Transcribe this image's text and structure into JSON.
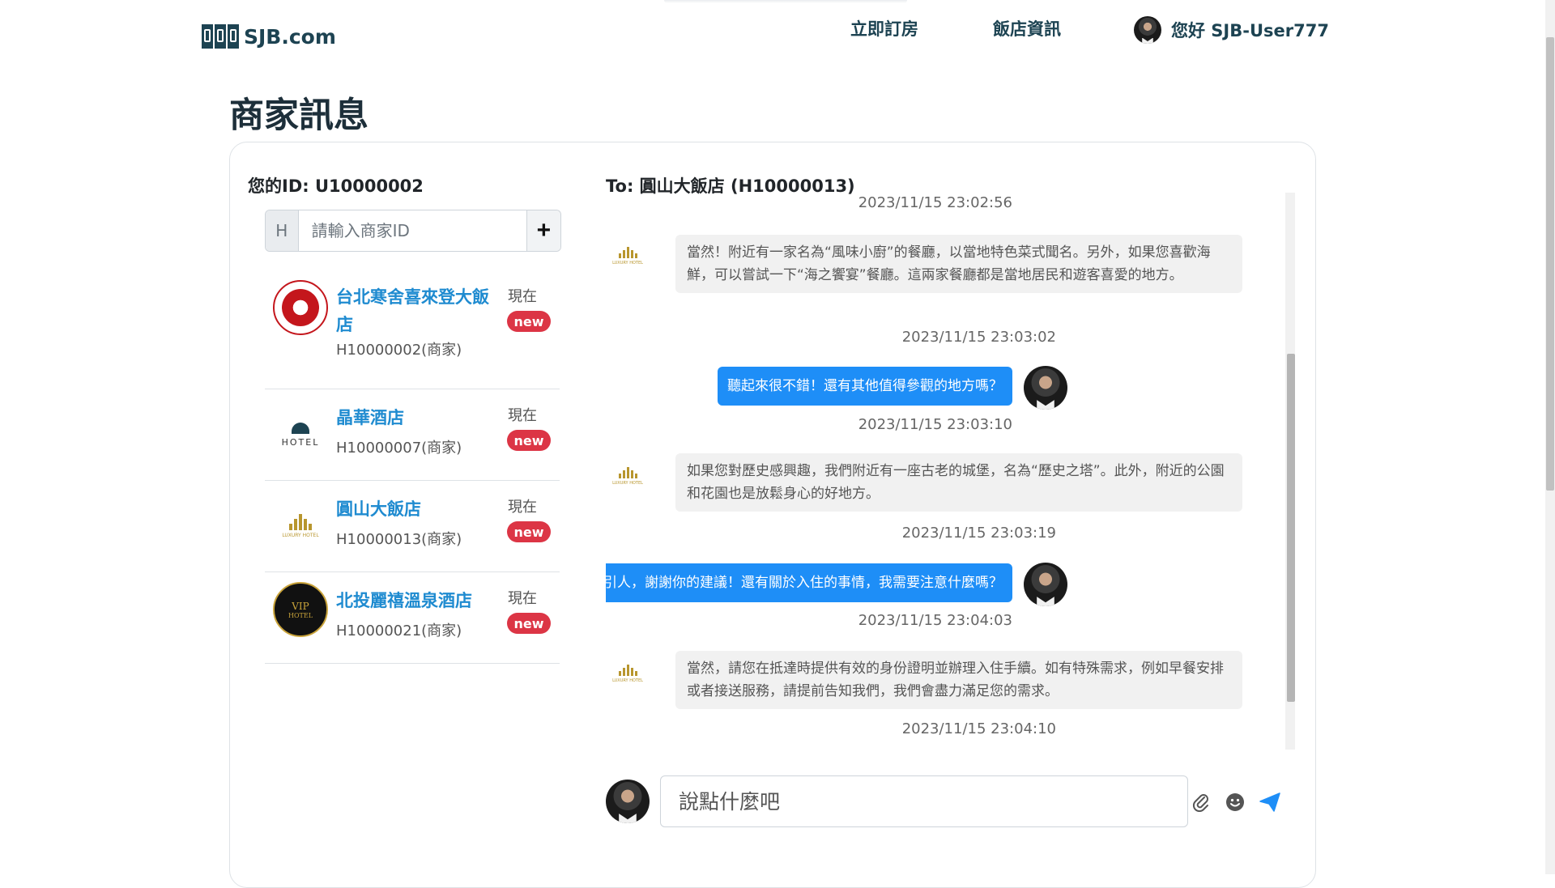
{
  "header": {
    "logo_text": "SJB.com",
    "nav_book": "立即訂房",
    "nav_info": "飯店資訊",
    "user_greeting": "您好 SJB-User777"
  },
  "page_title": "商家訊息",
  "left_panel": {
    "your_id": "您的ID: U10000002",
    "search_prefix": "H",
    "search_placeholder": "請輸入商家ID",
    "add_label": "+",
    "contacts": [
      {
        "name": "台北寒舍喜來登大飯店",
        "id": "H10000002(商家)",
        "time": "現在",
        "badge": "new",
        "logo": "red-flower-seal"
      },
      {
        "name": "晶華酒店",
        "id": "H10000007(商家)",
        "time": "現在",
        "badge": "new",
        "logo": "hotel-dome"
      },
      {
        "name": "圓山大飯店",
        "id": "H10000013(商家)",
        "time": "現在",
        "badge": "new",
        "logo": "luxury-hotel"
      },
      {
        "name": "北投麗禧溫泉酒店",
        "id": "H10000021(商家)",
        "time": "現在",
        "badge": "new",
        "logo": "vip-hotel"
      }
    ]
  },
  "chat": {
    "to": "To: 圓山大飯店 (H10000013)",
    "messages": [
      {
        "dir": "in",
        "ts": "2023/11/15 23:02:56",
        "ts_pos": "above",
        "text": "當然！附近有一家名為“風味小廚”的餐廳，以當地特色菜式聞名。另外，如果您喜歡海鮮，可以嘗試一下“海之饗宴”餐廳。這兩家餐廳都是當地居民和遊客喜愛的地方。",
        "ts_after": "2023/11/15 23:03:02"
      },
      {
        "dir": "out",
        "text": "聽起來很不錯！還有其他值得參觀的地方嗎？",
        "ts_after": "2023/11/15 23:03:10"
      },
      {
        "dir": "in",
        "text": "如果您對歷史感興趣，我們附近有一座古老的城堡，名為“歷史之塔”。此外，附近的公園和花園也是放鬆身心的好地方。",
        "ts_after": "2023/11/15 23:03:19"
      },
      {
        "dir": "out",
        "text": "聽起來都很吸引人，謝謝你的建議！還有關於入住的事情，我需要注意什麼嗎？",
        "ts_after": "2023/11/15 23:04:03"
      },
      {
        "dir": "in",
        "text": "當然，請您在抵達時提供有效的身份證明並辦理入住手續。如有特殊需求，例如早餐安排或者接送服務，請提前告知我們，我們會盡力滿足您的需求。",
        "ts_after": "2023/11/15 23:04:10"
      }
    ],
    "compose_placeholder": "說點什麼吧"
  },
  "colors": {
    "brand": "#1d4352",
    "link": "#1f8bd0",
    "badge": "#dc3545",
    "outgoing_bubble": "#1e8ef7",
    "incoming_bubble": "#f1f1f1"
  }
}
